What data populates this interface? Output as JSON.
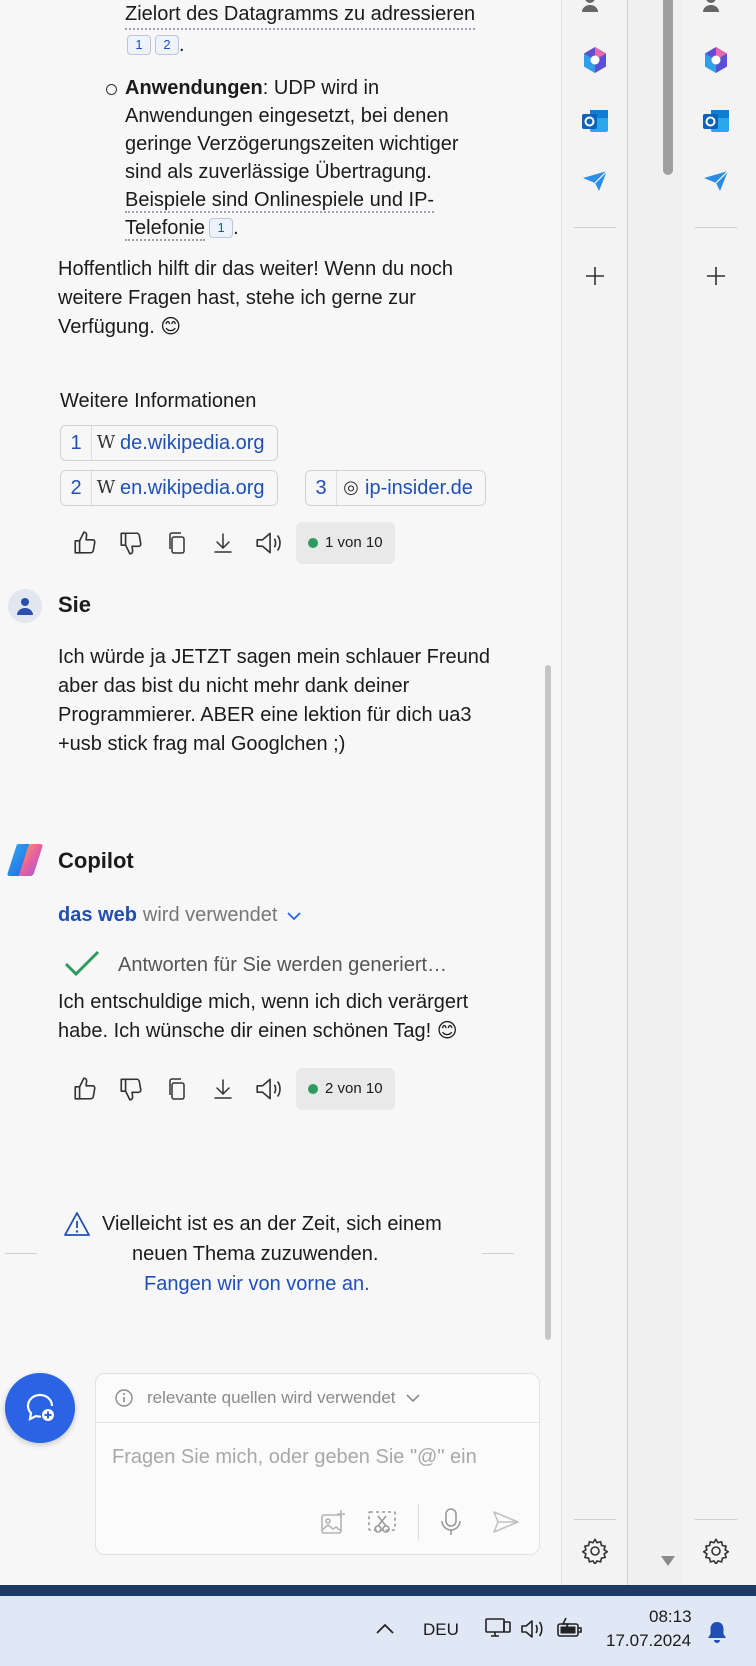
{
  "chat": {
    "top_line": "Zielort des Datagramms zu adressieren",
    "top_cites": [
      "1",
      "2"
    ],
    "bullet_title": "Anwendungen",
    "bullet_lines": [
      ": UDP wird in",
      "Anwendungen eingesetzt, bei denen",
      "geringe Verzögerungszeiten wichtiger",
      "sind als zuverlässige Übertragung."
    ],
    "bullet_link1": "Beispiele sind Onlinespiele und IP-",
    "bullet_link2": "Telefonie",
    "bullet_cite": "1",
    "closing_lines": [
      "Hoffentlich hilft dir das weiter! Wenn du noch",
      "weitere Fragen hast, stehe ich gerne zur",
      "Verfügung. 😊"
    ],
    "sources_title": "Weitere Informationen",
    "sources": [
      {
        "num": "1",
        "icon": "W",
        "domain": "de.wikipedia.org"
      },
      {
        "num": "2",
        "icon": "W",
        "domain": "en.wikipedia.org"
      },
      {
        "num": "3",
        "icon": "◎",
        "domain": "ip-insider.de"
      }
    ],
    "counter1": "1 von 10",
    "user_name": "Sie",
    "user_lines": [
      "Ich würde ja JETZT sagen mein schlauer Freund",
      "aber das bist du nicht mehr dank deiner",
      "Programmierer. ABER eine lektion für dich ua3",
      "+usb stick frag mal Googlchen ;)"
    ],
    "bot_name": "Copilot",
    "web_bold": "das web",
    "web_rest": "wird verwendet",
    "generating": "Antworten für Sie werden generiert…",
    "bot_lines": [
      "Ich entschuldige mich, wenn ich dich verärgert",
      "habe. Ich wünsche dir einen schönen Tag! 😊"
    ],
    "counter2": "2 von 10",
    "warning_line1": "Vielleicht ist es an der Zeit, sich einem",
    "warning_line2": "neuen Thema zuzuwenden.",
    "restart_link": "Fangen wir von vorne an.",
    "composer_sources": "relevante quellen wird verwendet",
    "composer_placeholder": "Fragen Sie mich, oder geben Sie \"@\" ein"
  },
  "taskbar": {
    "language": "DEU",
    "time": "08:13",
    "date": "17.07.2024"
  },
  "colors": {
    "link": "#1f4fb5",
    "accent": "#2a64e4",
    "success": "#2e9a5d",
    "taskbar_bg": "#dfe8f4"
  }
}
